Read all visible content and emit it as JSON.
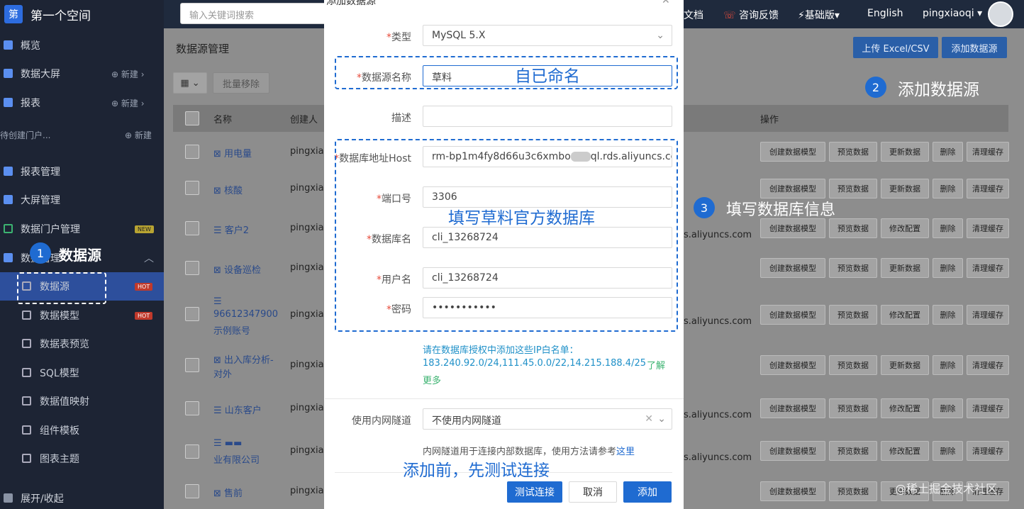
{
  "sidebar": {
    "logo_char": "第",
    "title": "第一个空间",
    "items": [
      {
        "label": "概览"
      },
      {
        "label": "数据大屏",
        "new": "新建"
      },
      {
        "label": "报表",
        "new": "新建"
      },
      {
        "label": "待创建门户...",
        "new": "新建"
      },
      {
        "label": "报表管理"
      },
      {
        "label": "大屏管理"
      },
      {
        "label": "数据门户管理",
        "badge": "NEW"
      },
      {
        "label": "数据管理"
      }
    ],
    "sub_items": [
      {
        "label": "数据源",
        "badge": "HOT"
      },
      {
        "label": "数据模型",
        "badge": "HOT"
      },
      {
        "label": "数据表预览"
      },
      {
        "label": "SQL模型"
      },
      {
        "label": "数据值映射"
      },
      {
        "label": "组件模板"
      },
      {
        "label": "图表主题"
      }
    ],
    "collapse": "展开/收起"
  },
  "topbar": {
    "search_placeholder": "输入关键词搜索",
    "doc": "文档",
    "feedback": "咨询反馈",
    "version": "基础版",
    "lang": "English",
    "user": "pingxiaoqi"
  },
  "page": {
    "title": "数据源管理",
    "upload_btn": "上传 Excel/CSV",
    "add_btn": "添加数据源",
    "batch_remove": "批量移除",
    "columns": [
      "名称",
      "创建人",
      "操作"
    ],
    "rows": [
      {
        "name": "用电量",
        "creator": "pingxiao",
        "host": "",
        "actions": [
          "创建数据模型",
          "预览数据",
          "更新数据",
          "删除",
          "清理缓存"
        ]
      },
      {
        "name": "核酸",
        "creator": "pingxiao",
        "host": "",
        "actions": [
          "创建数据模型",
          "预览数据",
          "更新数据",
          "删除",
          "清理缓存"
        ]
      },
      {
        "name": "客户2",
        "creator": "pingxiao",
        "host": "s.aliyuncs.com",
        "actions": [
          "创建数据模型",
          "预览数据",
          "修改配置",
          "删除",
          "清理缓存"
        ]
      },
      {
        "name": "设备巡检",
        "creator": "pingxiao",
        "host": "",
        "actions": [
          "创建数据模型",
          "预览数据",
          "更新数据",
          "删除",
          "清理缓存"
        ]
      },
      {
        "name": "96612347900",
        "name2": "示例账号",
        "creator": "pingxiao",
        "host": "s.aliyuncs.com",
        "actions": [
          "创建数据模型",
          "预览数据",
          "修改配置",
          "删除",
          "清理缓存"
        ]
      },
      {
        "name": "出入库分析-",
        "name2": "对外",
        "creator": "pingxiao",
        "host": "",
        "actions": [
          "创建数据模型",
          "预览数据",
          "更新数据",
          "删除",
          "清理缓存"
        ]
      },
      {
        "name": "山东客户",
        "creator": "pingxiao",
        "host": "s.aliyuncs.com",
        "actions": [
          "创建数据模型",
          "预览数据",
          "修改配置",
          "删除",
          "清理缓存"
        ]
      },
      {
        "name": "业有限公司",
        "creator": "pingxiao",
        "host": "s.aliyuncs.com",
        "actions": [
          "创建数据模型",
          "预览数据",
          "修改配置",
          "删除",
          "清理缓存"
        ]
      },
      {
        "name": "售前",
        "creator": "pingxiao",
        "host": "",
        "actions": [
          "创建数据模型",
          "预览数据",
          "更新数据",
          "删除",
          "清理缓存"
        ]
      }
    ]
  },
  "modal": {
    "title": "添加数据源",
    "fields": {
      "type": {
        "label": "类型",
        "value": "MySQL 5.X"
      },
      "name": {
        "label": "数据源名称",
        "value": "草料"
      },
      "desc": {
        "label": "描述",
        "value": ""
      },
      "host": {
        "label": "数据库地址Host",
        "value": "rm-bp1m4fy8d66u3c6xmbo",
        "value_tail": "ql.rds.aliyuncs.cc"
      },
      "port": {
        "label": "端口号",
        "value": "3306"
      },
      "db": {
        "label": "数据库名",
        "value": "cli_13268724"
      },
      "user": {
        "label": "用户名",
        "value": "cli_13268724"
      },
      "pwd": {
        "label": "密码",
        "value": "•••••••••••"
      },
      "tunnel": {
        "label": "使用内网隧道",
        "value": "不使用内网隧道"
      }
    },
    "ip_note_1": "请在数据库授权中添加这些IP白名单：",
    "ip_note_2": "183.240.92.0/24,111.45.0.0/22,14.215.188.4/25",
    "learn_more_1": "了解",
    "learn_more_2": "更多",
    "tunnel_note": "内网隧道用于连接内部数据库，使用方法请参考",
    "tunnel_link": "这里",
    "test_btn": "测试连接",
    "cancel_btn": "取消",
    "add_btn": "添加"
  },
  "annotations": {
    "a1_num": "1",
    "a1_text": "数据源",
    "a2_num": "2",
    "a2_text": "添加数据源",
    "a3_num": "3",
    "a3_text": "填写数据库信息",
    "name_hint": "自已命名",
    "db_hint": "填写草料官方数据库",
    "test_hint": "添加前，先测试连接"
  },
  "watermark": "@稀土掘金技术社区",
  "colors": {
    "accent": "#1f6bd1",
    "sidebar": "#1d2434",
    "hot": "#c0392b"
  }
}
